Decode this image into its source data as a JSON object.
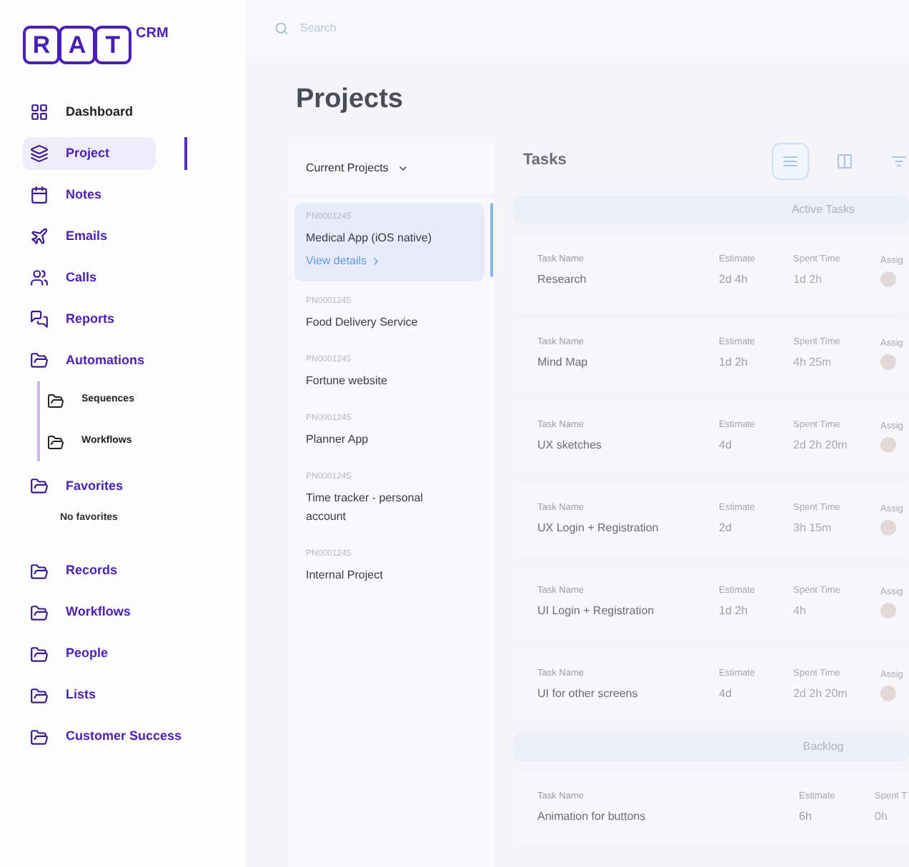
{
  "logo": {
    "letters": [
      "R",
      "A",
      "T"
    ],
    "suffix": "CRM"
  },
  "sidebar": {
    "items": [
      {
        "label": "Dashboard",
        "kind": "plain",
        "selected": false
      },
      {
        "label": "Project",
        "kind": "link",
        "selected": true
      },
      {
        "label": "Notes",
        "kind": "link",
        "selected": false
      },
      {
        "label": "Emails",
        "kind": "link",
        "selected": false
      },
      {
        "label": "Calls",
        "kind": "link",
        "selected": false
      },
      {
        "label": "Reports",
        "kind": "link",
        "selected": false
      },
      {
        "label": "Automations",
        "kind": "link",
        "selected": false,
        "expanded": true,
        "children": [
          {
            "label": "Sequences"
          },
          {
            "label": "Workflows"
          }
        ]
      },
      {
        "label": "Favorites",
        "kind": "link",
        "selected": false,
        "note": "No favorites"
      },
      {
        "label": "Records",
        "kind": "link",
        "selected": false
      },
      {
        "label": "Workflows",
        "kind": "link",
        "selected": false
      },
      {
        "label": "People",
        "kind": "link",
        "selected": false
      },
      {
        "label": "Lists",
        "kind": "link",
        "selected": false
      },
      {
        "label": "Customer Success",
        "kind": "link",
        "selected": false
      }
    ]
  },
  "search": {
    "placeholder": "Search"
  },
  "page_title": "Projects",
  "projects": {
    "filter": "Current Projects",
    "items": [
      {
        "code": "PN0001245",
        "name": "Medical App (iOS native)",
        "selected": true,
        "link": "View details"
      },
      {
        "code": "PN0001245",
        "name": "Food Delivery Service",
        "selected": false
      },
      {
        "code": "PN0001245",
        "name": "Fortune website",
        "selected": false
      },
      {
        "code": "PN0001245",
        "name": "Planner App",
        "selected": false
      },
      {
        "code": "PN0001245",
        "name": "Time tracker - personal account",
        "selected": false
      },
      {
        "code": "PN0001245",
        "name": "Internal Project",
        "selected": false
      }
    ]
  },
  "tasks": {
    "title": "Tasks",
    "views": [
      {
        "selected": true
      },
      {
        "selected": false
      },
      {
        "selected": false
      }
    ],
    "groups": [
      {
        "title": "Active Tasks",
        "rows": [
          {
            "labels": [
              "Task Name",
              "Estimate",
              "Spent Time",
              "Assig"
            ],
            "name": "Research",
            "estimate": "2d 4h",
            "spent": "1d 2h"
          },
          {
            "labels": [
              "Task Name",
              "Estimate",
              "Spent Time",
              "Assig"
            ],
            "name": "Mind Map",
            "estimate": "1d 2h",
            "spent": "4h 25m"
          },
          {
            "labels": [
              "Task Name",
              "Estimate",
              "Spent Time",
              "Assig"
            ],
            "name": "UX sketches",
            "estimate": "4d",
            "spent": "2d 2h 20m"
          },
          {
            "labels": [
              "Task Name",
              "Estimate",
              "Spent Time",
              "Assig"
            ],
            "name": "UX Login + Registration",
            "estimate": "2d",
            "spent": "3h 15m"
          },
          {
            "labels": [
              "Task Name",
              "Estimate",
              "Spent Time",
              "Assig"
            ],
            "name": "UI Login + Registration",
            "estimate": "1d 2h",
            "spent": "4h"
          },
          {
            "labels": [
              "Task Name",
              "Estimate",
              "Spent Time",
              "Assig"
            ],
            "name": "UI for other screens",
            "estimate": "4d",
            "spent": "2d 2h 20m"
          }
        ]
      },
      {
        "title": "Backlog",
        "rows": [
          {
            "labels": [
              "Task Name",
              "Estimate",
              "Spent T"
            ],
            "name": "Animation for buttons",
            "estimate": "6h",
            "spent": "0h"
          }
        ]
      }
    ]
  }
}
